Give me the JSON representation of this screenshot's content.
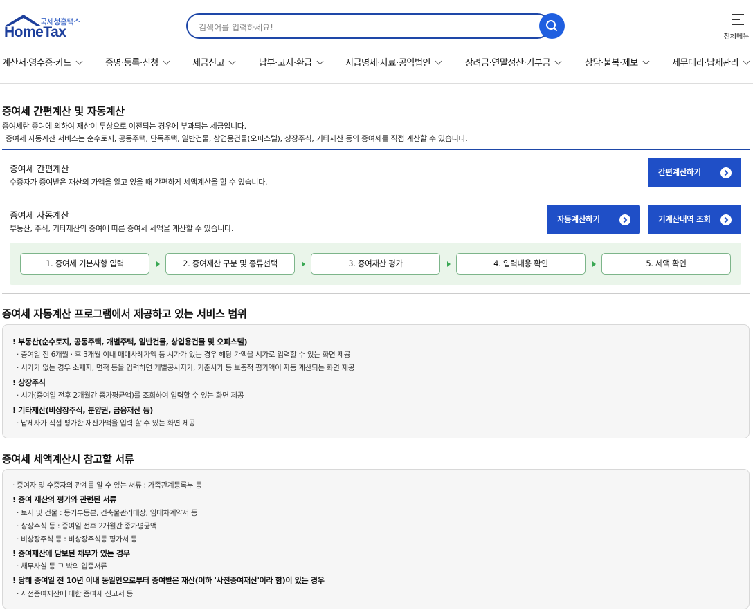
{
  "header": {
    "logo_sub": "국세청홈택스",
    "logo_main": "HomeTax",
    "search_placeholder": "검색어를 입력하세요!",
    "menu_all_label": "전체메뉴",
    "brand_color": "#1e47a8"
  },
  "nav": [
    {
      "label": "계산서·영수증·카드"
    },
    {
      "label": "증명·등록·신청"
    },
    {
      "label": "세금신고"
    },
    {
      "label": "납부·고지·환급"
    },
    {
      "label": "지급명세·자료·공익법인"
    },
    {
      "label": "장려금·연말정산·기부금"
    },
    {
      "label": "상담·불복·제보"
    },
    {
      "label": "세무대리·납세관리"
    }
  ],
  "intro": {
    "title": "증여세 간편계산 및 자동계산",
    "desc1": "증여세란 증여에 의하여 재산이 무상으로 이전되는 경우에 부과되는 세금입니다.",
    "desc2": "증여세 자동계산 서비스는 순수토지, 공동주택, 단독주택, 일반건물, 상업용건물(오피스텔), 상장주식, 기타재산 등의 증여세를 직접 계산할 수 있습니다."
  },
  "simple": {
    "title": "증여세 간편계산",
    "desc": "수증자가 증여받은 재산의 가액을 알고 있을 때 간편하게 세액계산을 할 수 있습니다.",
    "button": "간편계산하기"
  },
  "auto": {
    "title": "증여세 자동계산",
    "desc": "부동산, 주식, 기타재산의 증여에 따른 증여세 세액을 계산할 수 있습니다.",
    "button_auto": "자동계산하기",
    "button_history": "기계산내역 조회",
    "steps": [
      "1. 증여세 기본사항 입력",
      "2. 증여재산 구분 및 종류선택",
      "3. 증여재산 평가",
      "4. 입력내용 확인",
      "5. 세액 확인"
    ]
  },
  "scope": {
    "title": "증여세 자동계산 프로그램에서 제공하고 있는 서비스 범위",
    "items": [
      {
        "text": "! 부동산(순수토지, 공동주택, 개별주택, 일반건물, 상업용건물 및 오피스텔)",
        "bold": true
      },
      {
        "text": "· 증여일 전 6개월 · 후 3개월 이내 매매사례가액 등 시가가 있는 경우 해당 가액을 시가로 입력할 수 있는 화면 제공",
        "bold": false
      },
      {
        "text": "· 시가가 없는 경우 소재지, 면적 등을 입력하면 개별공시지가, 기준시가 등 보충적 평가액이 자동 계산되는 화면 제공",
        "bold": false
      },
      {
        "text": "! 상장주식",
        "bold": true
      },
      {
        "text": "· 시가(증여일 전후 2개월간 종가평균액)를 조회하여 입력할 수 있는 화면 제공",
        "bold": false
      },
      {
        "text": "! 기타재산(비상장주식, 분양권, 금융재산 등)",
        "bold": true
      },
      {
        "text": "· 납세자가 직접 평가한 재산가액을 입력 할 수 있는 화면 제공",
        "bold": false
      }
    ]
  },
  "docs": {
    "title": "증여세 세액계산시 참고할 서류",
    "items": [
      {
        "text": "· 증여자 및 수증자의 관계를 알 수 있는 서류 : 가족관계등록부 등",
        "bold": false
      },
      {
        "text": "! 증여 재산의 평가와 관련된 서류",
        "bold": true
      },
      {
        "text": "· 토지 및 건물 : 등기부등본, 건축물관리대장, 임대차계약서 등",
        "bold": false
      },
      {
        "text": "· 상장주식 등 : 증여일 전후 2개월간 종가평균액",
        "bold": false
      },
      {
        "text": "· 비상장주식 등 : 비상장주식등 평가서 등",
        "bold": false
      },
      {
        "text": "! 증여재산에 담보된 채무가 있는 경우",
        "bold": true
      },
      {
        "text": "· 채무사실 등 그 밖의 입증서류",
        "bold": false
      },
      {
        "text": "! 당해 증여일 전 10년 이내 동일인으로부터 증여받은 재산(이하 '사전증여재산'이라 함)이 있는 경우",
        "bold": true
      },
      {
        "text": "· 사전증여재산에 대한 증여세 신고서 등",
        "bold": false
      }
    ]
  }
}
